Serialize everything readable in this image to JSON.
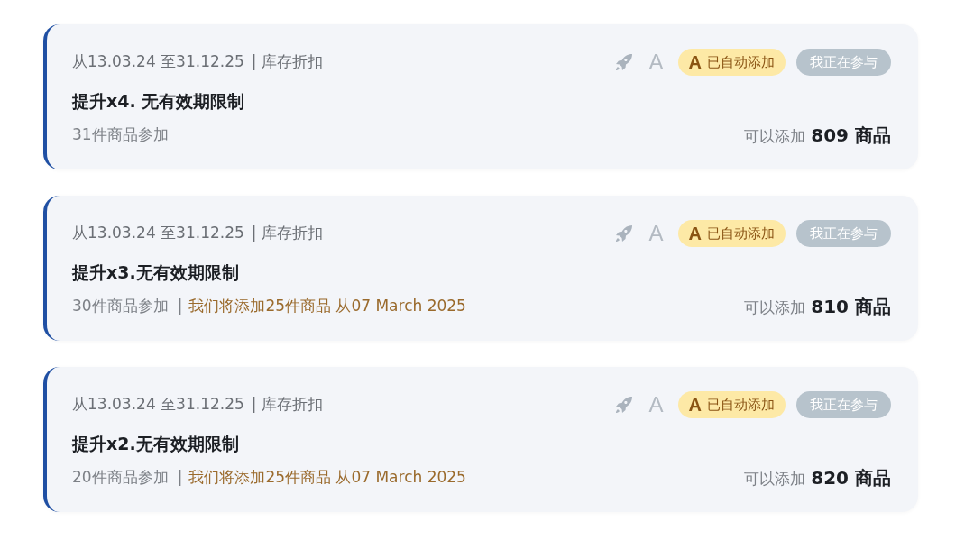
{
  "cards": [
    {
      "period": "从13.03.24 至31.12.25",
      "separator": "|",
      "category": "库存折扣",
      "icon_letter": "A",
      "auto_badge": {
        "letter": "A",
        "label": "已自动添加"
      },
      "status_button": "我正在参与",
      "title": "提升x4. 无有效期限制",
      "participants": "31件商品参加",
      "available_label": "可以添加",
      "available_count": "809 商品"
    },
    {
      "period": "从13.03.24 至31.12.25",
      "separator": "|",
      "category": "库存折扣",
      "icon_letter": "A",
      "auto_badge": {
        "letter": "A",
        "label": "已自动添加"
      },
      "status_button": "我正在参与",
      "title": "提升x3.无有效期限制",
      "participants": "30件商品参加",
      "notice_separator": "|",
      "notice": "我们将添加25件商品 从07 March 2025",
      "available_label": "可以添加",
      "available_count": "810 商品"
    },
    {
      "period": "从13.03.24 至31.12.25",
      "separator": "|",
      "category": "库存折扣",
      "icon_letter": "A",
      "auto_badge": {
        "letter": "A",
        "label": "已自动添加"
      },
      "status_button": "我正在参与",
      "title": "提升x2.无有效期限制",
      "participants": "20件商品参加",
      "notice_separator": "|",
      "notice": "我们将添加25件商品 从07 March 2025",
      "available_label": "可以添加",
      "available_count": "820 商品"
    }
  ]
}
